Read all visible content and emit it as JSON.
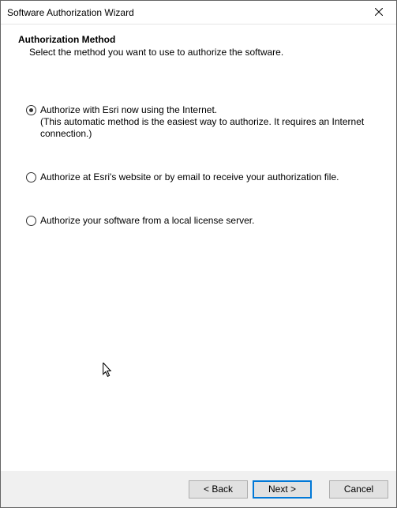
{
  "window": {
    "title": "Software Authorization Wizard"
  },
  "header": {
    "heading": "Authorization Method",
    "subheading": "Select the method you want to use to authorize the software."
  },
  "options": {
    "opt1_label": "Authorize with Esri now using the Internet.",
    "opt1_sub": "(This automatic method is the easiest way to authorize. It requires an Internet connection.)",
    "opt2_label": "Authorize at Esri's website or by email to receive your authorization file.",
    "opt3_label": "Authorize your software from a local license server."
  },
  "footer": {
    "back": "< Back",
    "next": "Next >",
    "cancel": "Cancel"
  }
}
